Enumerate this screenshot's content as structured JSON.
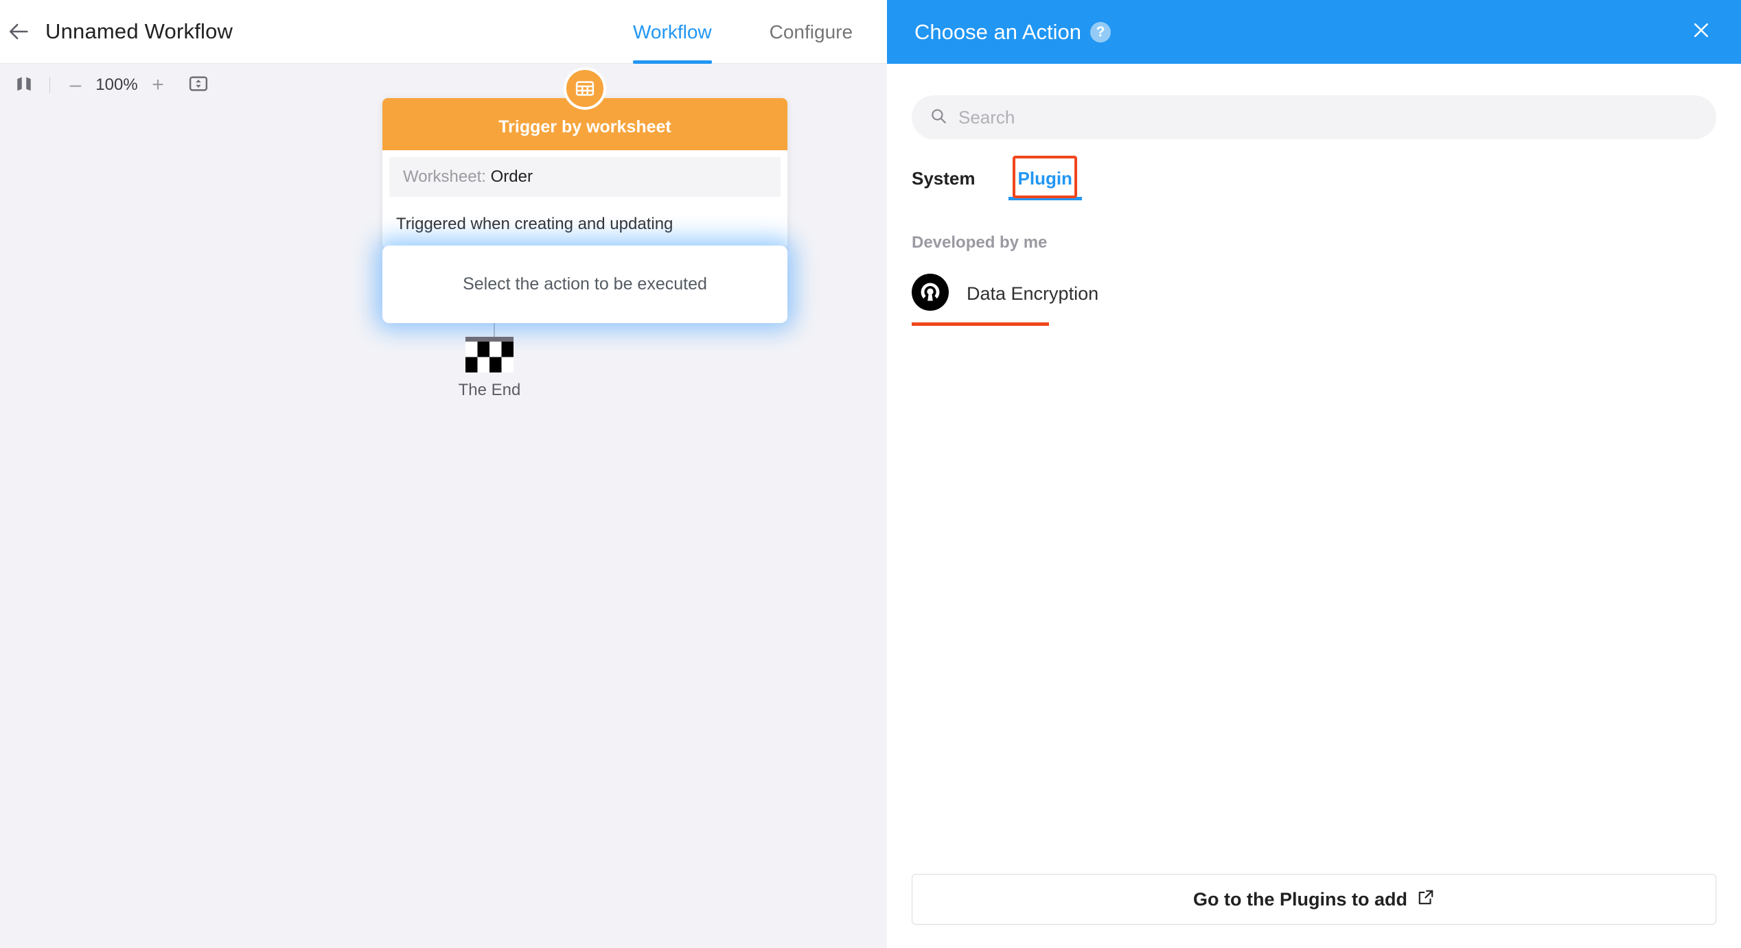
{
  "topbar": {
    "back_icon": "arrow-left-icon",
    "title": "Unnamed Workflow",
    "tabs": [
      {
        "label": "Workflow",
        "active": true
      },
      {
        "label": "Configure",
        "active": false
      }
    ]
  },
  "canvas_toolbar": {
    "map_icon": "map-icon",
    "zoom_out_label": "–",
    "zoom_value": "100%",
    "zoom_in_label": "+",
    "fit_icon": "fit-to-screen-icon"
  },
  "flow": {
    "trigger_node": {
      "badge_icon": "worksheet-grid-icon",
      "title": "Trigger by worksheet",
      "field_label": "Worksheet",
      "field_separator": ":",
      "field_value": "Order",
      "description": "Triggered when creating and updating"
    },
    "action_node": {
      "placeholder": "Select the action to be executed"
    },
    "end_node": {
      "icon": "checkered-flag-icon",
      "label": "The End"
    }
  },
  "panel": {
    "title": "Choose an Action",
    "help_icon": "help-circle-icon",
    "help_glyph": "?",
    "close_icon": "close-icon",
    "search": {
      "icon": "search-icon",
      "value": "",
      "placeholder": "Search"
    },
    "tabs": [
      {
        "label": "System",
        "active": false
      },
      {
        "label": "Plugin",
        "active": true
      }
    ],
    "section_title": "Developed by me",
    "plugins": [
      {
        "name": "Data Encryption",
        "icon": "data-encryption-keyhole-icon"
      }
    ],
    "footer_button": {
      "label": "Go to the Plugins to add",
      "icon": "external-link-icon"
    }
  },
  "colors": {
    "accent_blue": "#2196f3",
    "trigger_orange": "#f7a43c",
    "annotation_red": "#f0461c",
    "canvas_bg": "#f3f3f7",
    "panel_bg": "#ffffff"
  }
}
